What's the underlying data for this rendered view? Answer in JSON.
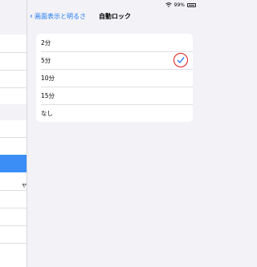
{
  "status": {
    "battery": "99%"
  },
  "nav": {
    "back_label": "画面表示と明るさ",
    "title": "自動ロック"
  },
  "options": [
    {
      "label": "2分",
      "selected": false
    },
    {
      "label": "5分",
      "selected": true
    },
    {
      "label": "10分",
      "selected": false
    },
    {
      "label": "15分",
      "selected": false
    },
    {
      "label": "なし",
      "selected": false
    }
  ],
  "colors": {
    "accent": "#1e78f0",
    "highlight_ring": "#e21818",
    "background": "#f2f2f7"
  },
  "left_pane": {
    "partial_glyph": "ャ"
  }
}
